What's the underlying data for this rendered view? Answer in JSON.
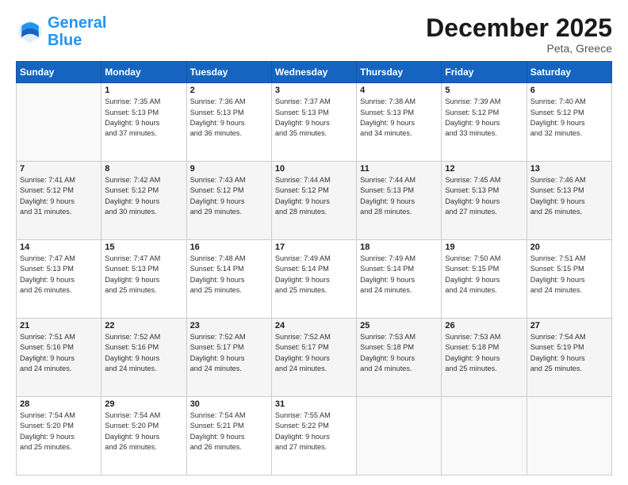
{
  "header": {
    "logo_general": "General",
    "logo_blue": "Blue",
    "month": "December 2025",
    "location": "Peta, Greece"
  },
  "days_of_week": [
    "Sunday",
    "Monday",
    "Tuesday",
    "Wednesday",
    "Thursday",
    "Friday",
    "Saturday"
  ],
  "weeks": [
    [
      {
        "day": "",
        "info": ""
      },
      {
        "day": "1",
        "info": "Sunrise: 7:35 AM\nSunset: 5:13 PM\nDaylight: 9 hours\nand 37 minutes."
      },
      {
        "day": "2",
        "info": "Sunrise: 7:36 AM\nSunset: 5:13 PM\nDaylight: 9 hours\nand 36 minutes."
      },
      {
        "day": "3",
        "info": "Sunrise: 7:37 AM\nSunset: 5:13 PM\nDaylight: 9 hours\nand 35 minutes."
      },
      {
        "day": "4",
        "info": "Sunrise: 7:38 AM\nSunset: 5:13 PM\nDaylight: 9 hours\nand 34 minutes."
      },
      {
        "day": "5",
        "info": "Sunrise: 7:39 AM\nSunset: 5:12 PM\nDaylight: 9 hours\nand 33 minutes."
      },
      {
        "day": "6",
        "info": "Sunrise: 7:40 AM\nSunset: 5:12 PM\nDaylight: 9 hours\nand 32 minutes."
      }
    ],
    [
      {
        "day": "7",
        "info": "Sunrise: 7:41 AM\nSunset: 5:12 PM\nDaylight: 9 hours\nand 31 minutes."
      },
      {
        "day": "8",
        "info": "Sunrise: 7:42 AM\nSunset: 5:12 PM\nDaylight: 9 hours\nand 30 minutes."
      },
      {
        "day": "9",
        "info": "Sunrise: 7:43 AM\nSunset: 5:12 PM\nDaylight: 9 hours\nand 29 minutes."
      },
      {
        "day": "10",
        "info": "Sunrise: 7:44 AM\nSunset: 5:12 PM\nDaylight: 9 hours\nand 28 minutes."
      },
      {
        "day": "11",
        "info": "Sunrise: 7:44 AM\nSunset: 5:13 PM\nDaylight: 9 hours\nand 28 minutes."
      },
      {
        "day": "12",
        "info": "Sunrise: 7:45 AM\nSunset: 5:13 PM\nDaylight: 9 hours\nand 27 minutes."
      },
      {
        "day": "13",
        "info": "Sunrise: 7:46 AM\nSunset: 5:13 PM\nDaylight: 9 hours\nand 26 minutes."
      }
    ],
    [
      {
        "day": "14",
        "info": "Sunrise: 7:47 AM\nSunset: 5:13 PM\nDaylight: 9 hours\nand 26 minutes."
      },
      {
        "day": "15",
        "info": "Sunrise: 7:47 AM\nSunset: 5:13 PM\nDaylight: 9 hours\nand 25 minutes."
      },
      {
        "day": "16",
        "info": "Sunrise: 7:48 AM\nSunset: 5:14 PM\nDaylight: 9 hours\nand 25 minutes."
      },
      {
        "day": "17",
        "info": "Sunrise: 7:49 AM\nSunset: 5:14 PM\nDaylight: 9 hours\nand 25 minutes."
      },
      {
        "day": "18",
        "info": "Sunrise: 7:49 AM\nSunset: 5:14 PM\nDaylight: 9 hours\nand 24 minutes."
      },
      {
        "day": "19",
        "info": "Sunrise: 7:50 AM\nSunset: 5:15 PM\nDaylight: 9 hours\nand 24 minutes."
      },
      {
        "day": "20",
        "info": "Sunrise: 7:51 AM\nSunset: 5:15 PM\nDaylight: 9 hours\nand 24 minutes."
      }
    ],
    [
      {
        "day": "21",
        "info": "Sunrise: 7:51 AM\nSunset: 5:16 PM\nDaylight: 9 hours\nand 24 minutes."
      },
      {
        "day": "22",
        "info": "Sunrise: 7:52 AM\nSunset: 5:16 PM\nDaylight: 9 hours\nand 24 minutes."
      },
      {
        "day": "23",
        "info": "Sunrise: 7:52 AM\nSunset: 5:17 PM\nDaylight: 9 hours\nand 24 minutes."
      },
      {
        "day": "24",
        "info": "Sunrise: 7:52 AM\nSunset: 5:17 PM\nDaylight: 9 hours\nand 24 minutes."
      },
      {
        "day": "25",
        "info": "Sunrise: 7:53 AM\nSunset: 5:18 PM\nDaylight: 9 hours\nand 24 minutes."
      },
      {
        "day": "26",
        "info": "Sunrise: 7:53 AM\nSunset: 5:18 PM\nDaylight: 9 hours\nand 25 minutes."
      },
      {
        "day": "27",
        "info": "Sunrise: 7:54 AM\nSunset: 5:19 PM\nDaylight: 9 hours\nand 25 minutes."
      }
    ],
    [
      {
        "day": "28",
        "info": "Sunrise: 7:54 AM\nSunset: 5:20 PM\nDaylight: 9 hours\nand 25 minutes."
      },
      {
        "day": "29",
        "info": "Sunrise: 7:54 AM\nSunset: 5:20 PM\nDaylight: 9 hours\nand 26 minutes."
      },
      {
        "day": "30",
        "info": "Sunrise: 7:54 AM\nSunset: 5:21 PM\nDaylight: 9 hours\nand 26 minutes."
      },
      {
        "day": "31",
        "info": "Sunrise: 7:55 AM\nSunset: 5:22 PM\nDaylight: 9 hours\nand 27 minutes."
      },
      {
        "day": "",
        "info": ""
      },
      {
        "day": "",
        "info": ""
      },
      {
        "day": "",
        "info": ""
      }
    ]
  ]
}
